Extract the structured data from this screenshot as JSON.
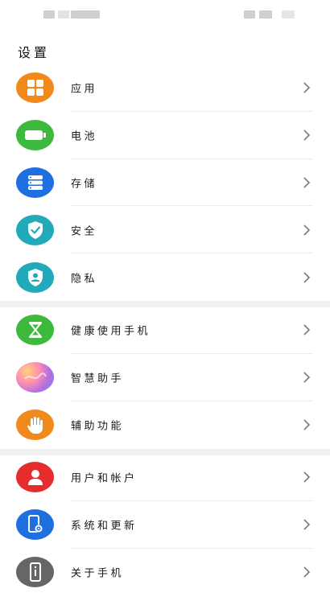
{
  "page": {
    "title": "设置"
  },
  "groups": [
    {
      "items": [
        {
          "label": "应用",
          "icon": "apps-grid-icon",
          "color": "#F08A1C"
        },
        {
          "label": "电池",
          "icon": "battery-icon",
          "color": "#3DBA3D"
        },
        {
          "label": "存储",
          "icon": "storage-icon",
          "color": "#1E6FE0"
        },
        {
          "label": "安全",
          "icon": "shield-check-icon",
          "color": "#22AABB"
        },
        {
          "label": "隐私",
          "icon": "privacy-shield-icon",
          "color": "#22AABB"
        }
      ]
    },
    {
      "items": [
        {
          "label": "健康使用手机",
          "icon": "hourglass-icon",
          "color": "#3DBA3D"
        },
        {
          "label": "智慧助手",
          "icon": "assistant-gradient-icon",
          "color": "#C86DD7"
        },
        {
          "label": "辅助功能",
          "icon": "hand-icon",
          "color": "#F08A1C"
        }
      ]
    },
    {
      "items": [
        {
          "label": "用户和帐户",
          "icon": "user-icon",
          "color": "#E52D2D"
        },
        {
          "label": "系统和更新",
          "icon": "phone-gear-icon",
          "color": "#1E6FE0"
        },
        {
          "label": "关于手机",
          "icon": "phone-info-icon",
          "color": "#666666"
        }
      ]
    }
  ]
}
